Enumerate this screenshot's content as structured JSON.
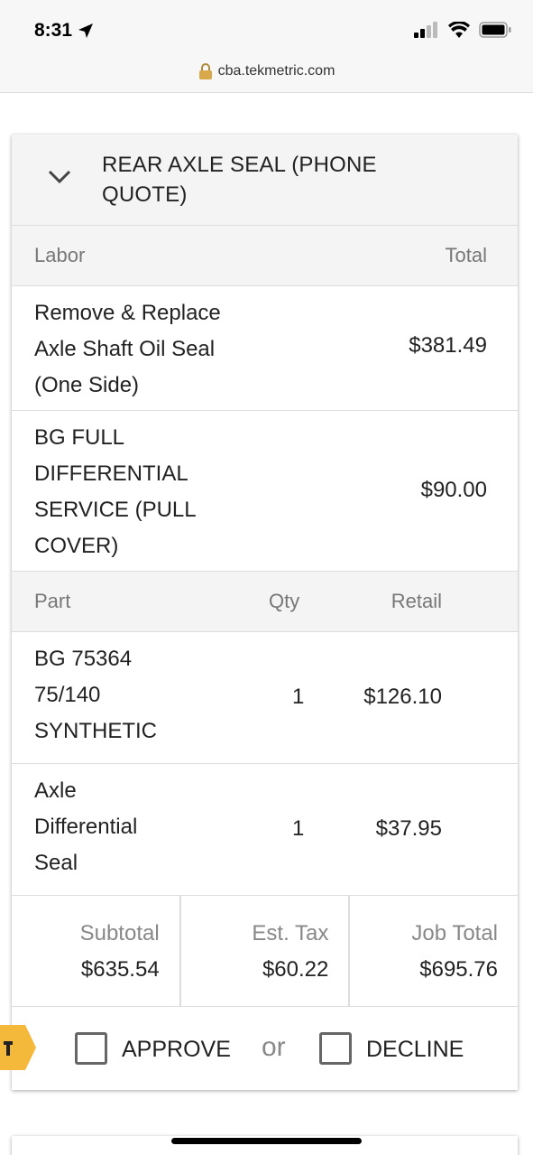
{
  "status_bar": {
    "time": "8:31",
    "url": "cba.tekmetric.com"
  },
  "job": {
    "title": "REAR AXLE SEAL (PHONE QUOTE)",
    "labor_header": {
      "col1": "Labor",
      "col2": "Total"
    },
    "labor": [
      {
        "description": "Remove & Replace Axle Shaft Oil Seal (One Side)",
        "total": "$381.49"
      },
      {
        "description": "BG FULL DIFFERENTIAL SERVICE (PULL COVER)",
        "total": "$90.00"
      }
    ],
    "parts_header": {
      "col1": "Part",
      "col2": "Qty",
      "col3": "Retail"
    },
    "parts": [
      {
        "description": "BG 75364 75/140 SYNTHETIC",
        "qty": "1",
        "retail": "$126.10"
      },
      {
        "description": "Axle Differential Seal",
        "qty": "1",
        "retail": "$37.95"
      }
    ],
    "totals": {
      "subtotal_label": "Subtotal",
      "subtotal": "$635.54",
      "tax_label": "Est. Tax",
      "tax": "$60.22",
      "job_total_label": "Job Total",
      "job_total": "$695.76"
    },
    "actions": {
      "approve_label": "APPROVE",
      "or_label": "or",
      "decline_label": "DECLINE"
    }
  },
  "colors": {
    "tag": "#f4b93b",
    "header_bg": "#f4f4f4"
  }
}
